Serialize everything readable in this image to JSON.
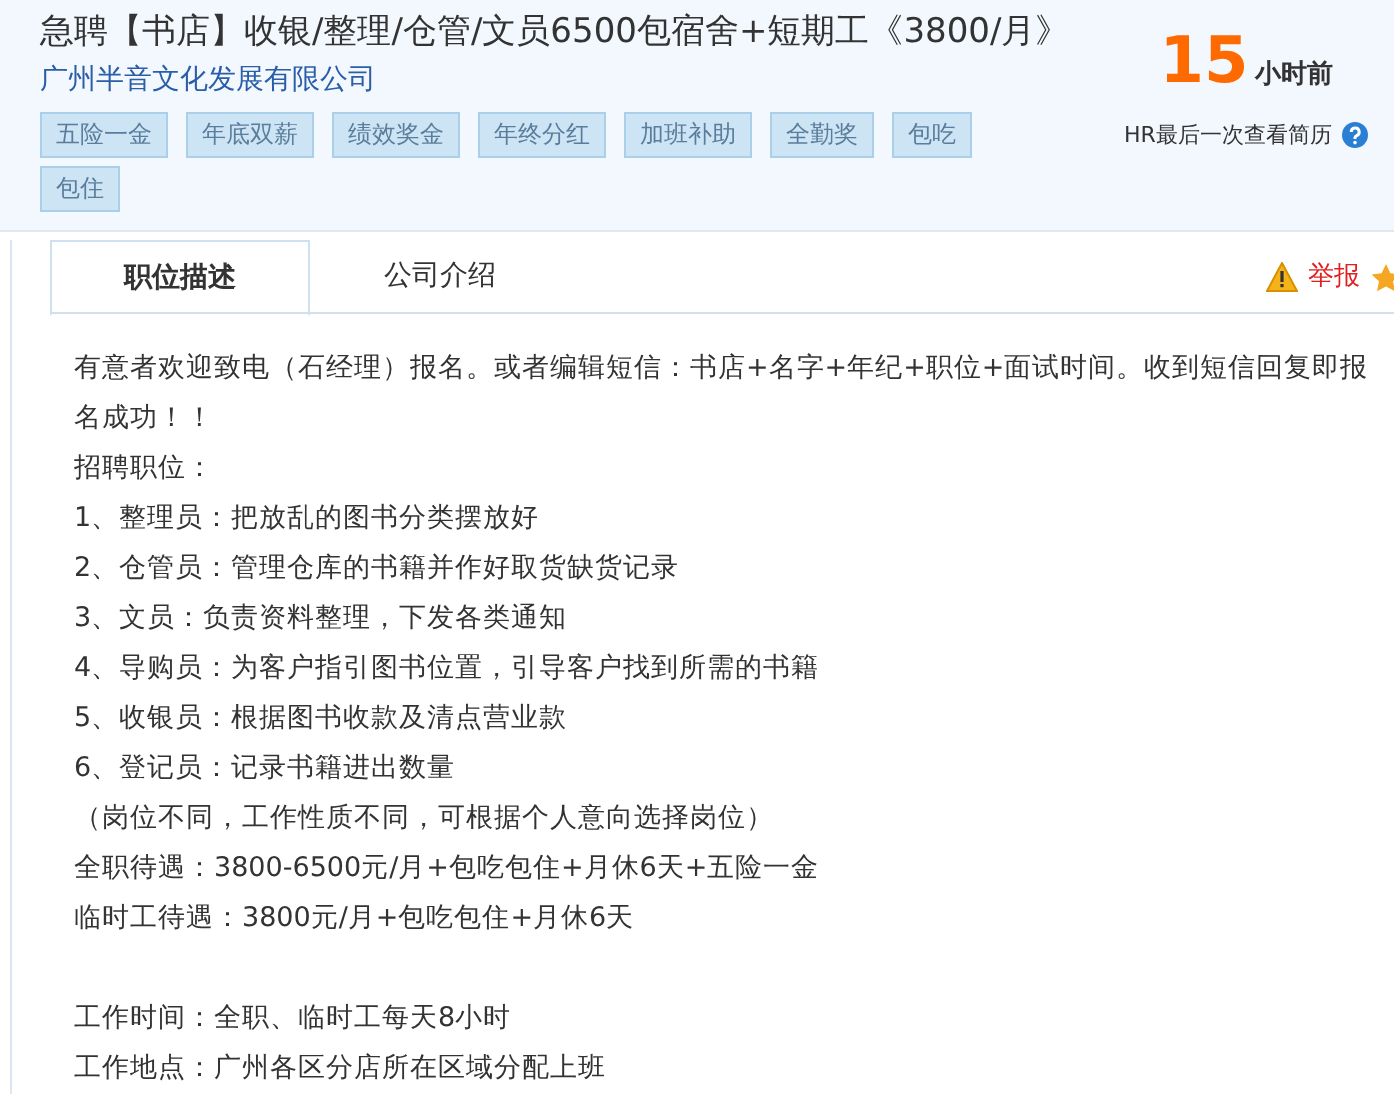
{
  "job": {
    "title": "急聘【书店】收银/整理/仓管/文员6500包宿舍+短期工《3800/月》",
    "company": "广州半音文化发展有限公司",
    "tags": [
      "五险一金",
      "年底双薪",
      "绩效奖金",
      "年终分红",
      "加班补助",
      "全勤奖",
      "包吃",
      "包住"
    ]
  },
  "activity": {
    "number": "15",
    "unit": "小时前",
    "caption": "HR最后一次查看简历"
  },
  "tabs": [
    {
      "label": "职位描述",
      "selected": true
    },
    {
      "label": "公司介绍",
      "selected": false
    }
  ],
  "report": "举报",
  "description_paragraphs": [
    [
      "有意者欢迎致电（石经理）报名。或者编辑短信：书店+名字+年纪+职位+面试时间。收到短信回复即报名成功！！",
      "招聘职位：",
      "1、整理员：把放乱的图书分类摆放好",
      "2、仓管员：管理仓库的书籍并作好取货缺货记录",
      "3、文员：负责资料整理，下发各类通知",
      "4、导购员：为客户指引图书位置，引导客户找到所需的书籍",
      "5、收银员：根据图书收款及清点营业款",
      "6、登记员：记录书籍进出数量",
      "（岗位不同，工作性质不同，可根据个人意向选择岗位）",
      "全职待遇：3800-6500元/月+包吃包住+月休6天+五险一金",
      "临时工待遇：3800元/月+包吃包住+月休6天"
    ],
    [
      "工作时间：全职、临时工每天8小时",
      "工作地点：广州各区分店所在区域分配上班"
    ]
  ]
}
